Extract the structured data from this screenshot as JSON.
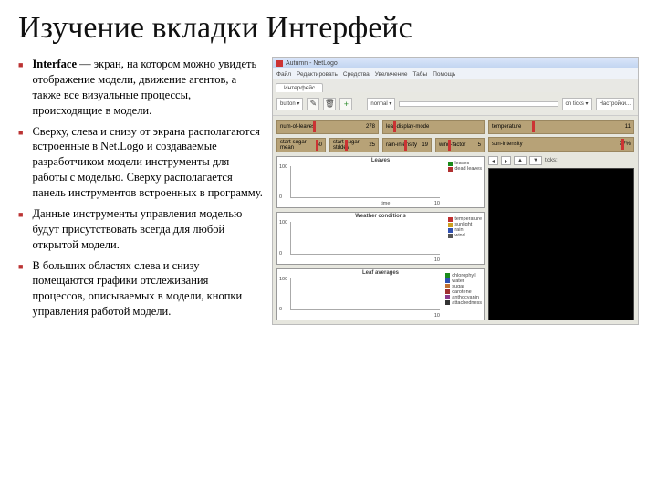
{
  "title": "Изучение вкладки Интерфейс",
  "bullets": [
    {
      "bold": "Interface",
      "text": " — экран, на котором можно увидеть отображение модели, движение агентов, а также все визуальные процессы, происходящие в модели."
    },
    {
      "bold": "",
      "text": "Сверху, слева и снизу от экрана располагаются встроенные в Net.Logo и создаваемые разработчиком модели инструменты для работы с моделью. Сверху располагается панель инструментов встроенных в программу."
    },
    {
      "bold": "",
      "text": "Данные инструменты управления моделью будут присутствовать всегда для любой открытой модели."
    },
    {
      "bold": "",
      "text": "В больших областях слева и снизу помещаются графики отслеживания процессов, описываемых в модели, кнопки управления работой модели."
    }
  ],
  "app": {
    "window_title": "Autumn - NetLogo",
    "menus": [
      "Файл",
      "Редактировать",
      "Средства",
      "Увеличение",
      "Табы",
      "Помощь"
    ],
    "tabs": [
      "Интерфейс"
    ],
    "toolbar": {
      "dropdown1": "button ▾",
      "edit": "✎",
      "trash": "🗑",
      "add": "+",
      "zoom": "normal ▾",
      "viewupdates": "on ticks ▾",
      "settings": "Настройки..."
    },
    "sliders_left": [
      {
        "label": "num-of-leaves",
        "value": "278",
        "knob": 35
      },
      {
        "label": "start-sugar-mean",
        "value": "50",
        "knob": 80
      },
      {
        "label": "start-sugar-stddev",
        "value": "25",
        "knob": 30
      }
    ],
    "sliders_right_top": [
      {
        "label": "leaf-display-mode",
        "value": "",
        "knob": 10
      },
      {
        "label": "rain-intensity",
        "value": "19",
        "knob": 45
      },
      {
        "label": "wind-factor",
        "value": "5",
        "knob": 25
      }
    ],
    "sliders_right": [
      {
        "label": "temperature",
        "value": "11",
        "knob": 30
      },
      {
        "label": "sun-intensity",
        "value": "97%",
        "knob": 92
      }
    ],
    "view_header": {
      "ticks": "ticks:",
      "arrows": [
        "◂",
        "▸",
        "▲",
        "▼"
      ]
    },
    "plots": [
      {
        "title": "Leaves",
        "ylabel_top": "100",
        "ylabel_bot": "0",
        "xlabel_r": "10",
        "xlabel": "time",
        "legend": [
          {
            "c": "#1a8a1a",
            "t": "leaves"
          },
          {
            "c": "#b03030",
            "t": "dead leaves"
          }
        ]
      },
      {
        "title": "Weather conditions",
        "ylabel_top": "100",
        "ylabel_bot": "0",
        "xlabel_r": "10",
        "xlabel": "",
        "legend": [
          {
            "c": "#c03030",
            "t": "temperature"
          },
          {
            "c": "#cca020",
            "t": "sunlight"
          },
          {
            "c": "#3050b0",
            "t": "rain"
          },
          {
            "c": "#555",
            "t": "wind"
          }
        ]
      },
      {
        "title": "Leaf averages",
        "ylabel_top": "100",
        "ylabel_bot": "0",
        "xlabel_r": "10",
        "xlabel": "",
        "legend": [
          {
            "c": "#1a8a1a",
            "t": "chlorophyll"
          },
          {
            "c": "#3050b0",
            "t": "water"
          },
          {
            "c": "#c07030",
            "t": "sugar"
          },
          {
            "c": "#a03030",
            "t": "carotene"
          },
          {
            "c": "#8a3a8a",
            "t": "anthocyanin"
          },
          {
            "c": "#333",
            "t": "attachedness"
          }
        ]
      }
    ]
  }
}
